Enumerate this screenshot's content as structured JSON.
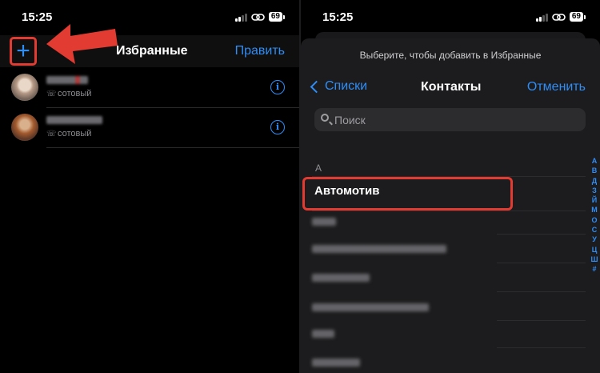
{
  "left": {
    "status": {
      "time": "15:25",
      "battery": "69"
    },
    "nav": {
      "add_symbol": "+",
      "title": "Избранные",
      "edit_label": "Править"
    },
    "favorites": [
      {
        "subtitle": "сотовый",
        "info_symbol": "i"
      },
      {
        "subtitle": "сотовый",
        "info_symbol": "i"
      }
    ]
  },
  "right": {
    "status": {
      "time": "15:25",
      "battery": "69"
    },
    "prompt": "Выберите, чтобы добавить в Избранные",
    "nav": {
      "back_label": "Списки",
      "title": "Контакты",
      "cancel_label": "Отменить"
    },
    "search": {
      "placeholder": "Поиск"
    },
    "section_letter": "А",
    "first_contact": "Автомотив",
    "index_letters": [
      "А",
      "В",
      "Д",
      "З",
      "Й",
      "М",
      "О",
      "С",
      "У",
      "Ц",
      "Ш",
      "#"
    ]
  },
  "colors": {
    "accent": "#2f8df6",
    "highlight": "#e23b31",
    "background": "#000000",
    "sheet": "#1c1c1e"
  }
}
